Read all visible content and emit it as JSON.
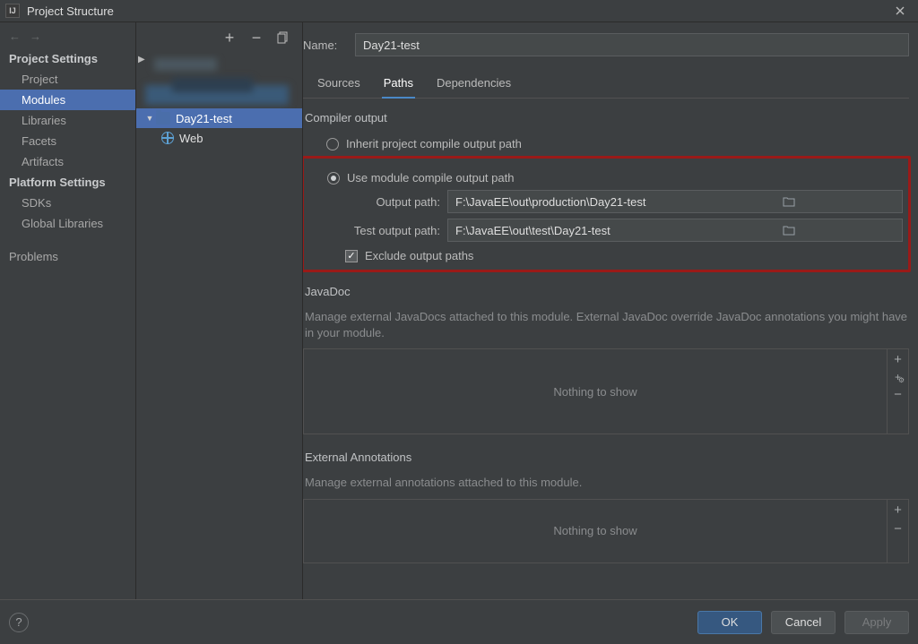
{
  "window": {
    "title": "Project Structure"
  },
  "nav": {
    "project_settings_header": "Project Settings",
    "items_project": [
      "Project",
      "Modules",
      "Libraries",
      "Facets",
      "Artifacts"
    ],
    "active_project_item": "Modules",
    "platform_header": "Platform Settings",
    "items_platform": [
      "SDKs",
      "Global Libraries"
    ],
    "problems": "Problems"
  },
  "tree": {
    "module": "Day21-test",
    "web": "Web"
  },
  "main": {
    "name_label": "Name:",
    "name_value": "Day21-test",
    "tabs": [
      "Sources",
      "Paths",
      "Dependencies"
    ],
    "active_tab": "Paths",
    "compiler_output_title": "Compiler output",
    "inherit_label": "Inherit project compile output path",
    "use_module_label": "Use module compile output path",
    "output_path_label": "Output path:",
    "output_path_value": "F:\\JavaEE\\out\\production\\Day21-test",
    "test_output_label": "Test output path:",
    "test_output_value": "F:\\JavaEE\\out\\test\\Day21-test",
    "exclude_label": "Exclude output paths",
    "javadoc_title": "JavaDoc",
    "javadoc_desc": "Manage external JavaDocs attached to this module. External JavaDoc override JavaDoc annotations you might have in your module.",
    "nothing": "Nothing to show",
    "ext_title": "External Annotations",
    "ext_desc": "Manage external annotations attached to this module."
  },
  "footer": {
    "ok": "OK",
    "cancel": "Cancel",
    "apply": "Apply"
  }
}
